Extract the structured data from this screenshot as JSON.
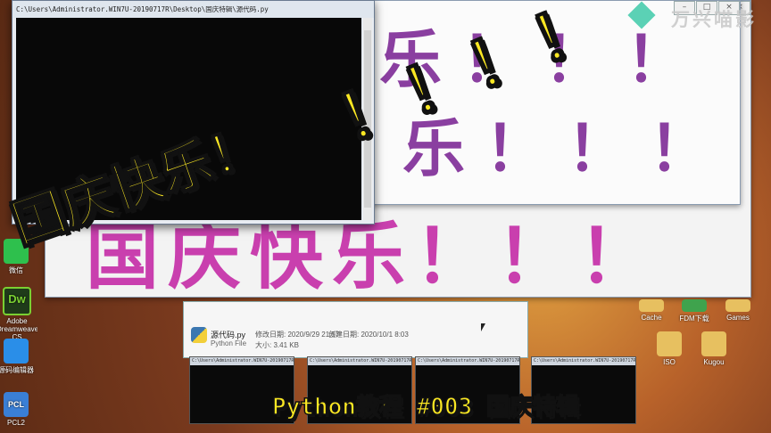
{
  "console": {
    "title": "C:\\Users\\Administrator.WIN7U-20190717R\\Desktop\\国庆特辑\\源代码.py"
  },
  "turtle": {
    "text_upper": "乐！！！",
    "text_mid": "乐！！！",
    "text_lower": "国庆快乐！！！"
  },
  "desktop_icons": [
    {
      "label": "微信",
      "icon": "wechat-icon",
      "color": "#2ec04d"
    },
    {
      "label": "Adobe Dreamweaver CS",
      "icon": "dreamweaver-icon",
      "color": "#1f3b1a"
    },
    {
      "label": "源码编辑器",
      "icon": "code-editor-icon",
      "color": "#2a8ee8"
    },
    {
      "label": "PCL2",
      "icon": "pcl2-icon",
      "color": "#3a7fd6"
    }
  ],
  "right_icons": [
    {
      "label": "Cache",
      "icon": "folder-icon"
    },
    {
      "label": "FDM下载",
      "icon": "fdm-icon"
    },
    {
      "label": "Games",
      "icon": "folder-icon"
    },
    {
      "label": "ISO",
      "icon": "folder-icon"
    },
    {
      "label": "Kugou",
      "icon": "folder-icon"
    }
  ],
  "explorer": {
    "file_name": "源代码.py",
    "file_type": "Python File",
    "modified_label": "修改日期: 2020/9/29 21:57",
    "created_label": "创建日期: 2020/10/1 8:03",
    "size_label": "大小: 3.41 KB"
  },
  "sticker": {
    "text": "国庆快乐！",
    "exclaims": "！！！！"
  },
  "caption": "Python教程 #003 国庆特辑",
  "watermark": "万兴喵影",
  "colors": {
    "sticker_yellow": "#fbe823",
    "turtle_pink": "#c93fae",
    "turtle_purple": "#8a3fa0"
  }
}
